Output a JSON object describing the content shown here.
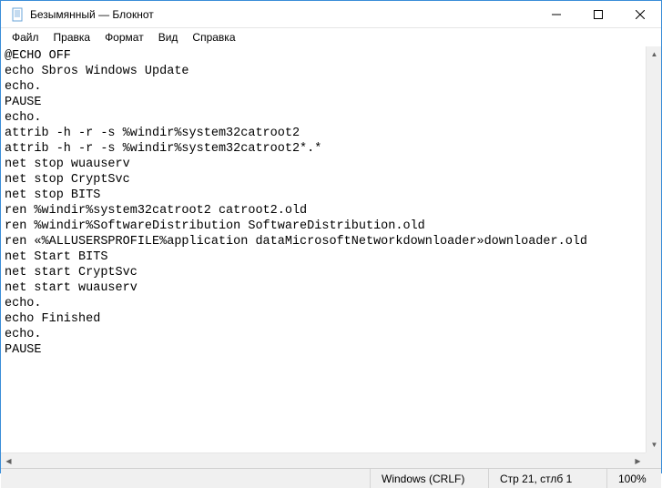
{
  "window": {
    "title": "Безымянный — Блокнот"
  },
  "menu": {
    "file": "Файл",
    "edit": "Правка",
    "format": "Формат",
    "view": "Вид",
    "help": "Справка"
  },
  "content": {
    "lines": [
      "@ECHO OFF",
      "echo Sbros Windows Update",
      "echo.",
      "PAUSE",
      "echo.",
      "attrib -h -r -s %windir%system32catroot2",
      "attrib -h -r -s %windir%system32catroot2*.*",
      "net stop wuauserv",
      "net stop CryptSvc",
      "net stop BITS",
      "ren %windir%system32catroot2 catroot2.old",
      "ren %windir%SoftwareDistribution SoftwareDistribution.old",
      "ren «%ALLUSERSPROFILE%application dataMicrosoftNetworkdownloader»downloader.old",
      "net Start BITS",
      "net start CryptSvc",
      "net start wuauserv",
      "echo.",
      "echo Finished",
      "echo.",
      "PAUSE"
    ]
  },
  "status": {
    "encoding": "Windows (CRLF)",
    "position": "Стр 21, стлб 1",
    "zoom": "100%"
  }
}
